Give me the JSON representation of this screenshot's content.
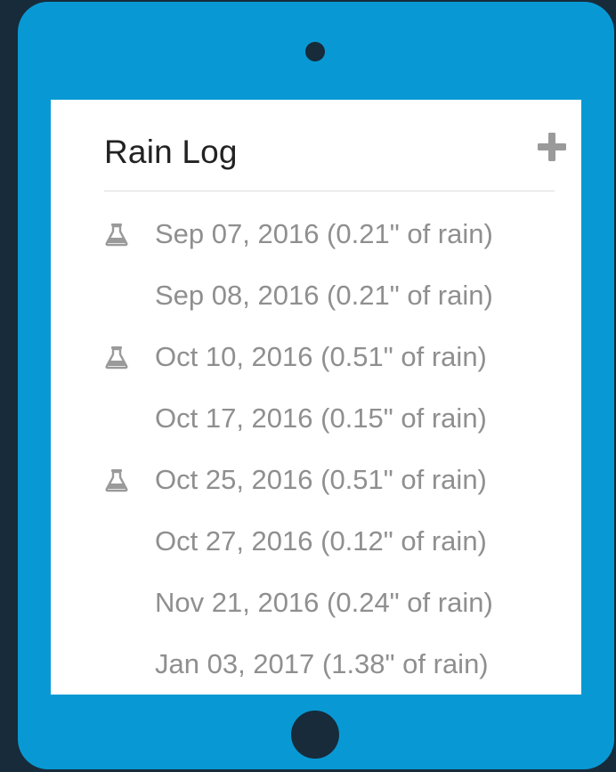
{
  "app": {
    "title": "Rain Log",
    "add_icon": "plus-icon"
  },
  "colors": {
    "device": "#0899d5",
    "background": "#172b3a",
    "screen": "#ffffff",
    "entry_text": "#8f8f8f",
    "icon": "#9a9a9a"
  },
  "log": [
    {
      "text": "Sep 07, 2016 (0.21\" of rain)",
      "icon": "flask-icon"
    },
    {
      "text": "Sep 08, 2016 (0.21\" of rain)",
      "icon": null
    },
    {
      "text": "Oct 10, 2016 (0.51\" of rain)",
      "icon": "flask-icon"
    },
    {
      "text": "Oct 17, 2016 (0.15\" of rain)",
      "icon": null
    },
    {
      "text": "Oct 25, 2016 (0.51\" of rain)",
      "icon": "flask-icon"
    },
    {
      "text": "Oct 27, 2016 (0.12\" of rain)",
      "icon": null
    },
    {
      "text": "Nov 21, 2016 (0.24\" of rain)",
      "icon": null
    },
    {
      "text": "Jan 03, 2017 (1.38\" of rain)",
      "icon": null
    }
  ]
}
